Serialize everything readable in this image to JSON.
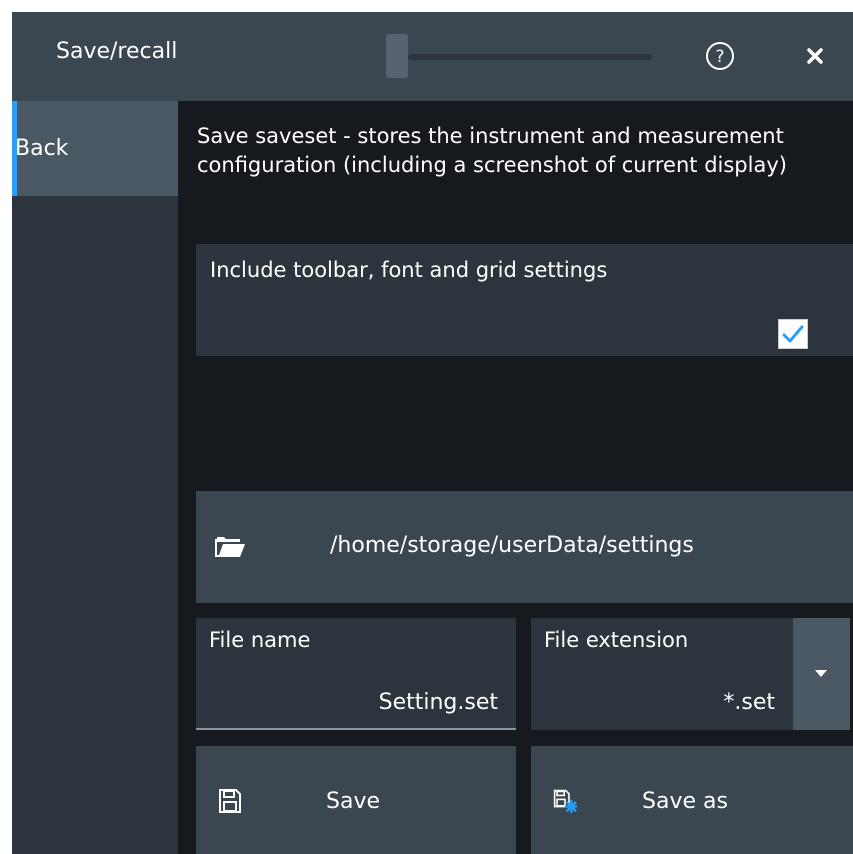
{
  "dialog": {
    "title": "Save/recall",
    "help_label": "?",
    "close_label": "×"
  },
  "sidebar": {
    "items": [
      {
        "label": "Back",
        "selected": true
      }
    ]
  },
  "main": {
    "description": "Save saveset - stores the instrument and measurement configuration (including a screenshot of current display)",
    "include_option": {
      "label": "Include toolbar, font and grid settings",
      "checked": true
    },
    "path": "/home/storage/userData/settings",
    "file_name": {
      "label": "File name",
      "value": "Setting.set"
    },
    "file_extension": {
      "label": "File extension",
      "value": "*.set"
    },
    "buttons": {
      "save": "Save",
      "save_as": "Save as"
    }
  },
  "icons": {
    "help": "help-icon",
    "close": "close-icon",
    "folder": "folder-open-icon",
    "save": "floppy-disk-icon",
    "save_as": "floppy-disk-asterisk-icon",
    "dropdown": "triangle-down-icon",
    "check": "checkmark-icon"
  },
  "colors": {
    "accent": "#2a9df4",
    "background": "#16191e",
    "panel": "#2c353d",
    "panel_light": "#3a4650",
    "selected": "#4a5863"
  }
}
